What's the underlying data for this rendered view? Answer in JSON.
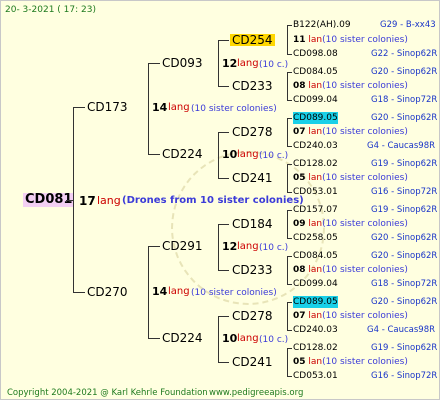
{
  "header": {
    "date": "20-  3-2021  (  17:  23)"
  },
  "root": {
    "name": "CD081",
    "gen_num": "17",
    "lang": "lang",
    "note": "(Drones from 10 sister colonies)"
  },
  "level1": [
    {
      "name": "CD173",
      "num": "14",
      "lang": "lang",
      "note": "(10 sister colonies)"
    },
    {
      "name": "CD270",
      "num": "14",
      "lang": "lang",
      "note": "(10 sister colonies)"
    }
  ],
  "level2": [
    {
      "name": "CD093",
      "num": "12",
      "lang": "lang",
      "note": "(10 c.)"
    },
    {
      "name": "CD224",
      "num": "10",
      "lang": "lang",
      "note": "(10 c.)"
    },
    {
      "name": "CD291",
      "num": "12",
      "lang": "lang",
      "note": "(10 c.)"
    },
    {
      "name": "CD224",
      "num": "10",
      "lang": "lang",
      "note": "(10 c.)"
    }
  ],
  "level3": [
    {
      "name": "CD254",
      "num": "11",
      "lang": "lan",
      "note": "(10 sister colonies)"
    },
    {
      "name": "CD233",
      "num": "08",
      "lang": "lan",
      "note": "(10 sister colonies)"
    },
    {
      "name": "CD278",
      "num": "07",
      "lang": "lan",
      "note": "(10 sister colonies)"
    },
    {
      "name": "CD241",
      "num": "05",
      "lang": "lan",
      "note": "(10 sister colonies)"
    },
    {
      "name": "CD184",
      "num": "09",
      "lang": "lan",
      "note": "(10 sister colonies)"
    },
    {
      "name": "CD233",
      "num": "08",
      "lang": "lan",
      "note": "(10 sister colonies)"
    },
    {
      "name": "CD278",
      "num": "07",
      "lang": "lan",
      "note": "(10 sister colonies)"
    },
    {
      "name": "CD241",
      "num": "05",
      "lang": "lan",
      "note": "(10 sister colonies)"
    }
  ],
  "leaves": [
    {
      "name": "B122(AH).09",
      "code": "G29 - B-xx43"
    },
    {
      "name": "CD098.08",
      "code": "G22 - Sinop62R"
    },
    {
      "name": "CD084.05",
      "code": "G20 - Sinop62R"
    },
    {
      "name": "CD099.04",
      "code": "G18 - Sinop72R"
    },
    {
      "name": "CD089.05",
      "code": "G20 - Sinop62R"
    },
    {
      "name": "CD240.03",
      "code": "G4 - Caucas98R"
    },
    {
      "name": "CD128.02",
      "code": "G19 - Sinop62R"
    },
    {
      "name": "CD053.01",
      "code": "G16 - Sinop72R"
    },
    {
      "name": "CD157.07",
      "code": "G19 - Sinop62R"
    },
    {
      "name": "CD258.05",
      "code": "G20 - Sinop62R"
    },
    {
      "name": "CD084.05",
      "code": "G20 - Sinop62R"
    },
    {
      "name": "CD099.04",
      "code": "G18 - Sinop72R"
    },
    {
      "name": "CD089.05",
      "code": "G20 - Sinop62R"
    },
    {
      "name": "CD240.03",
      "code": "G4 - Caucas98R"
    },
    {
      "name": "CD128.02",
      "code": "G19 - Sinop62R"
    },
    {
      "name": "CD053.01",
      "code": "G16 - Sinop72R"
    }
  ],
  "footer": {
    "copyright": "Copyright 2004-2021 @ Karl Kehrle Foundation",
    "site": "www.pedigreeapis.org"
  },
  "colors": {
    "background": "#ffffe0",
    "root_highlight": "#f3cff3",
    "yellow_highlight": "#ffd700",
    "cyan_highlight": "#19d0e8",
    "lang": "#cc0000",
    "note": "#3b3bd8",
    "code": "#1a35c8",
    "footer": "#1e7a1e"
  }
}
